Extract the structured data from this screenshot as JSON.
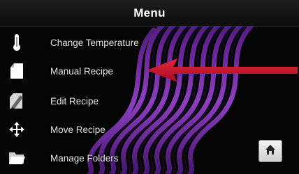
{
  "header": {
    "title": "Menu"
  },
  "menu": {
    "items": [
      {
        "label": "Change Temperature",
        "icon": "thermometer-icon"
      },
      {
        "label": "Manual Recipe",
        "icon": "document-icon"
      },
      {
        "label": "Edit Recipe",
        "icon": "edit-document-icon"
      },
      {
        "label": "Move Recipe",
        "icon": "move-arrows-icon"
      },
      {
        "label": "Manage Folders",
        "icon": "folder-icon"
      }
    ]
  },
  "home_button": {
    "icon": "home-icon"
  },
  "colors": {
    "background": "#050505",
    "accent_wave": "#8a3bc4",
    "arrow": "#d0102a"
  }
}
